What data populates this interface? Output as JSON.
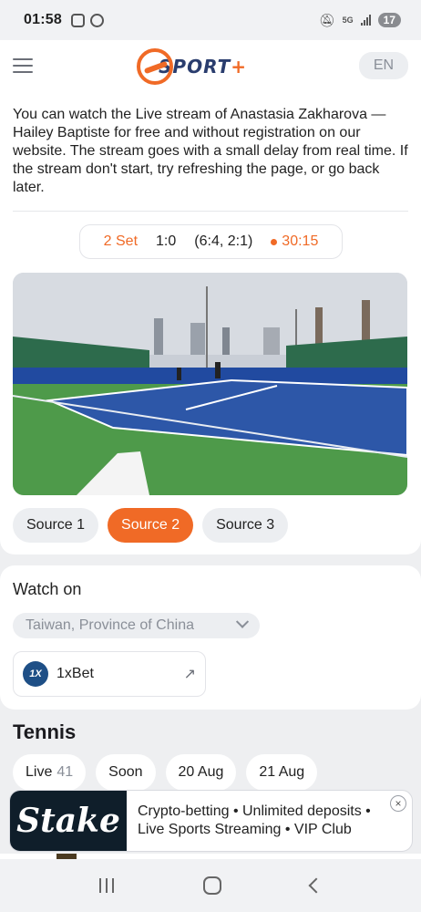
{
  "status_bar": {
    "time": "01:58",
    "network": "5G",
    "battery": "17"
  },
  "header": {
    "logo_text": "SPORT",
    "logo_plus": "+",
    "lang": "EN"
  },
  "match": {
    "description": "You can watch the Live stream of Anastasia Zakharova — Hailey Baptiste for free and without registration on our website. The stream goes with a small delay from real time. If the stream don't start, try refreshing the page, or go back later.",
    "set_label": "2 Set",
    "score": "1:0",
    "sets": "(6:4, 2:1)",
    "time": "30:15"
  },
  "sources": [
    {
      "label": "Source 1",
      "active": false
    },
    {
      "label": "Source 2",
      "active": true
    },
    {
      "label": "Source 3",
      "active": false
    }
  ],
  "watch_on": {
    "title": "Watch on",
    "region": "Taiwan, Province of China",
    "bookmaker_logo": "1X",
    "bookmaker_name": "1xBet"
  },
  "tennis": {
    "title": "Tennis",
    "chips": [
      {
        "label": "Live",
        "count": "41"
      },
      {
        "label": "Soon",
        "count": ""
      },
      {
        "label": "20 Aug",
        "count": ""
      },
      {
        "label": "21 Aug",
        "count": ""
      }
    ]
  },
  "ad": {
    "brand": "Stake",
    "text": "Crypto-betting • Unlimited deposits • Live Sports Streaming • VIP Club",
    "close_icon": "×"
  },
  "colors": {
    "accent": "#f06a26",
    "court": "#2d57a8",
    "grass": "#4e9a4a"
  },
  "icons": [
    "menu-icon",
    "chevron-down-icon",
    "external-link-icon",
    "close-icon",
    "mute-icon",
    "signal-icon"
  ]
}
